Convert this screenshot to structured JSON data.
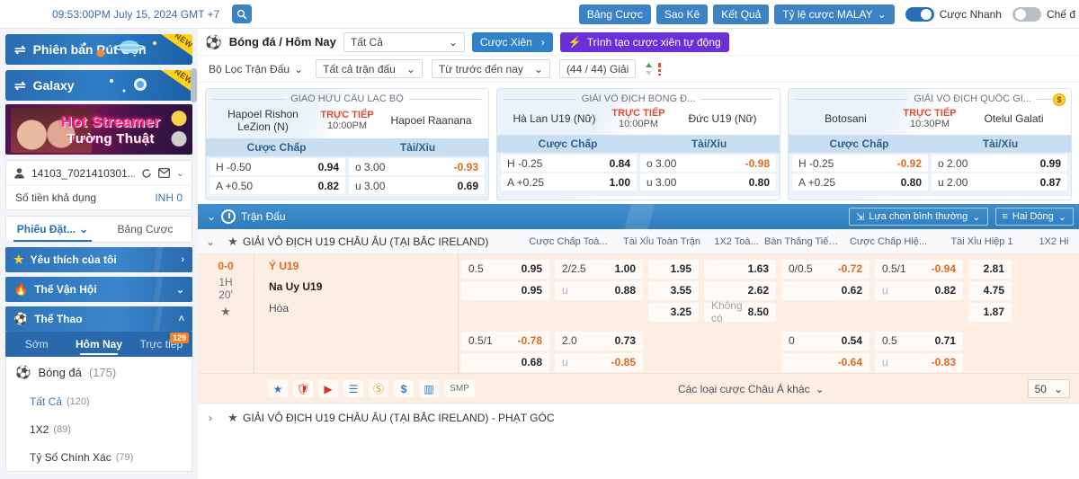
{
  "topbar": {
    "clock": "09:53:00PM July 15, 2024 GMT +7",
    "search_icon": "search-icon",
    "buttons": [
      {
        "label": "Bảng Cược"
      },
      {
        "label": "Sao Kê"
      },
      {
        "label": "Kết Quả"
      },
      {
        "label": "Tỷ lệ cược MALAY",
        "caret": "⌄"
      }
    ],
    "toggles": [
      {
        "label": "Cược Nhanh",
        "state": "on"
      },
      {
        "label": "Chế đ",
        "state": "off"
      }
    ]
  },
  "sidebar": {
    "promos": [
      {
        "label": "Phiên bản Rút Gọn",
        "badge": "NEW",
        "icon": "swap-icon"
      },
      {
        "label": "Galaxy",
        "badge": "NEW",
        "icon": "swap-icon"
      }
    ],
    "banner": {
      "line1": "Hot Streamer",
      "line2": "Tường Thuật"
    },
    "account": {
      "name": "14103_7021410301...",
      "refresh_icon": "refresh-icon",
      "mail_icon": "mail-icon",
      "chevron_icon": "chevron-down-icon",
      "balance_label": "Số tiền khả dụng",
      "balance_value": "INH 0"
    },
    "betslip_tabs": [
      {
        "label": "Phiếu Đặt...",
        "active": true,
        "caret": "⌄"
      },
      {
        "label": "Bảng Cược",
        "active": false
      }
    ],
    "nav": [
      {
        "label": "Yêu thích của tôi",
        "icon": "star-icon",
        "chevron": "›"
      },
      {
        "label": "Thế Vận Hội",
        "icon": "torch-icon",
        "chevron": "⌄"
      },
      {
        "label": "Thể Thao",
        "icon": "soccer-ball-icon",
        "chevron": "˄"
      }
    ],
    "sub_tabs": [
      {
        "label": "Sớm",
        "active": false
      },
      {
        "label": "Hôm Nay",
        "active": true
      },
      {
        "label": "Trực tiếp",
        "active": false,
        "badge": "129"
      }
    ],
    "sport_header": {
      "label": "Bóng đá",
      "count": "(175)",
      "icon": "soccer-ball-icon"
    },
    "sport_items": [
      {
        "label": "Tất Cả",
        "count": "(120)",
        "selected": true
      },
      {
        "label": "1X2",
        "count": "(89)",
        "selected": false
      },
      {
        "label": "Tỷ Số Chính Xác",
        "count": "(79)",
        "selected": false
      }
    ]
  },
  "main": {
    "header": {
      "title": "Bóng đá / Hôm Nay",
      "ball_icon": "soccer-ball-icon",
      "select_all": "Tất Cả",
      "parlay_btn": "Cược Xiên",
      "parlay_arrow": "›",
      "auto_parlay_btn": "Trình tạo cược xiên tự động",
      "auto_parlay_icon": "lightning-icon"
    },
    "filters": [
      {
        "label": "Bộ Lọc Trận Đấu",
        "caret": "⌄",
        "boxed": false
      },
      {
        "label": "Tất cả trận đấu",
        "caret": "⌄",
        "boxed": true
      },
      {
        "label": "Từ trước đến nay",
        "caret": "⌄",
        "boxed": true
      },
      {
        "label": "(44 / 44) Giải",
        "caret": "",
        "boxed": true
      }
    ],
    "sort_icon": "sort-asc-desc-icon",
    "featured_cards": [
      {
        "league": "GIAO HỮU CÂU LẠC BỘ",
        "home": "Hapoel Rishon LeZion (N)",
        "away": "Hapoel Raanana",
        "live_label": "TRỰC TIẾP",
        "time": "10:00PM",
        "coin": false,
        "col1": "Cược Chấp",
        "col2": "Tài/Xỉu",
        "rows": [
          {
            "hk": "H -0.50",
            "hv": "0.94",
            "hneg": false,
            "ok": "o 3.00",
            "ov": "-0.93",
            "oneg": true
          },
          {
            "hk": "A +0.50",
            "hv": "0.82",
            "hneg": false,
            "ok": "u 3.00",
            "ov": "0.69",
            "oneg": false
          }
        ]
      },
      {
        "league": "GIẢI VÔ ĐỊCH BÓNG Đ...",
        "home": "Hà Lan U19 (Nữ)",
        "away": "Đức U19 (Nữ)",
        "live_label": "TRỰC TIẾP",
        "time": "10:00PM",
        "coin": false,
        "col1": "Cược Chấp",
        "col2": "Tài/Xỉu",
        "rows": [
          {
            "hk": "H -0.25",
            "hv": "0.84",
            "hneg": false,
            "ok": "o 3.00",
            "ov": "-0.98",
            "oneg": true
          },
          {
            "hk": "A +0.25",
            "hv": "1.00",
            "hneg": false,
            "ok": "u 3.00",
            "ov": "0.80",
            "oneg": false
          }
        ]
      },
      {
        "league": "GIẢI VÔ ĐỊCH QUỐC GI...",
        "home": "Botosani",
        "away": "Otelul Galati",
        "live_label": "TRỰC TIẾP",
        "time": "10:30PM",
        "coin": true,
        "coin_icon": "coin-icon",
        "col1": "Cược Chấp",
        "col2": "Tài/Xỉu",
        "rows": [
          {
            "hk": "H -0.25",
            "hv": "-0.92",
            "hneg": true,
            "ok": "o 2.00",
            "ov": "0.99",
            "oneg": false
          },
          {
            "hk": "A +0.25",
            "hv": "0.80",
            "hneg": false,
            "ok": "u 2.00",
            "ov": "0.87",
            "oneg": false
          }
        ]
      }
    ],
    "match_bar": {
      "title": "Trận Đấu",
      "chevron": "⌄",
      "clock_icon": "clock-icon",
      "view_option": "Lựa chọn bình thường",
      "view_option_icon": "filter-lines-icon",
      "rows_option": "Hai Dòng",
      "rows_option_icon": "rows-icon"
    },
    "league_row": {
      "chevron": "⌄",
      "star_icon": "star-icon",
      "name": "GIẢI VÔ ĐỊCH U19 CHÂU ÂU (TẠI BẮC IRELAND)"
    },
    "column_headers": [
      "Cược Chấp Toà...",
      "Tài Xỉu Toàn Trận",
      "1X2 Toà...",
      "Bàn Thắng Tiếp...",
      "Cược Chấp Hiệ...",
      "Tài Xỉu Hiệp 1",
      "1X2 Hi"
    ],
    "match": {
      "score": "0-0",
      "period": "1H",
      "minute": "20'",
      "fav_icon": "star-icon",
      "home": "Ý U19",
      "away": "Na Uy U19",
      "draw": "Hòa",
      "rows": [
        [
          {
            "k": "0.5",
            "v": "0.95",
            "neg": false
          },
          {
            "k": "2/2.5",
            "v": "1.00",
            "neg": false
          },
          {
            "k": "",
            "v": "1.95",
            "neg": false,
            "single": true
          },
          {
            "k": "",
            "v": "1.63",
            "neg": false,
            "single": true
          },
          {
            "k": "0/0.5",
            "v": "-0.72",
            "neg": true
          },
          {
            "k": "0.5/1",
            "v": "-0.94",
            "neg": true
          },
          {
            "k": "",
            "v": "2.81",
            "neg": false,
            "single": true
          }
        ],
        [
          {
            "k": "",
            "v": "0.95",
            "neg": false
          },
          {
            "k": "u",
            "v": "0.88",
            "neg": false,
            "under": true
          },
          {
            "k": "",
            "v": "3.55",
            "neg": false,
            "single": true
          },
          {
            "k": "",
            "v": "2.62",
            "neg": false,
            "single": true
          },
          {
            "k": "",
            "v": "0.62",
            "neg": false
          },
          {
            "k": "u",
            "v": "0.82",
            "neg": false,
            "under": true
          },
          {
            "k": "",
            "v": "4.75",
            "neg": false,
            "single": true
          }
        ],
        [
          {
            "blank": true
          },
          {
            "blank": true
          },
          {
            "k": "",
            "v": "3.25",
            "neg": false,
            "single": true
          },
          {
            "k": "Không có",
            "v": "8.50",
            "neg": false,
            "nobet": true
          },
          {
            "blank": true
          },
          {
            "blank": true
          },
          {
            "k": "",
            "v": "1.87",
            "neg": false,
            "single": true
          }
        ],
        [
          {
            "k": "0.5/1",
            "v": "-0.78",
            "neg": true
          },
          {
            "k": "2.0",
            "v": "0.73",
            "neg": false
          },
          {
            "blank": true
          },
          {
            "blank": true
          },
          {
            "k": "0",
            "v": "0.54",
            "neg": false
          },
          {
            "k": "0.5",
            "v": "0.71",
            "neg": false
          },
          {
            "blank": true
          }
        ],
        [
          {
            "k": "",
            "v": "0.68",
            "neg": false
          },
          {
            "k": "u",
            "v": "-0.85",
            "neg": true,
            "under": true
          },
          {
            "blank": true
          },
          {
            "blank": true
          },
          {
            "k": "",
            "v": "-0.64",
            "neg": true
          },
          {
            "k": "u",
            "v": "-0.83",
            "neg": true,
            "under": true
          },
          {
            "blank": true
          }
        ]
      ],
      "icons": [
        {
          "name": "star-icon",
          "glyph": "★"
        },
        {
          "name": "fire-shield-icon",
          "glyph": "◆"
        },
        {
          "name": "play-video-icon",
          "glyph": "▶"
        },
        {
          "name": "stats-table-icon",
          "glyph": "☰"
        },
        {
          "name": "coin-icon",
          "glyph": "Ⓢ"
        },
        {
          "name": "cashout-icon",
          "glyph": "$"
        },
        {
          "name": "bar-chart-icon",
          "glyph": "▐"
        },
        {
          "name": "smp-icon",
          "glyph": "SMP"
        }
      ],
      "other_bets": "Các loại cược Châu Á khác",
      "other_bets_caret": "⌄",
      "page_size": "50",
      "page_size_caret": "⌄"
    },
    "league_row2": {
      "chevron": "›",
      "star_icon": "star-icon",
      "name": "GIẢI VÔ ĐỊCH U19 CHÂU ÂU (TẠI BẮC IRELAND) - PHẠT GÓC"
    }
  }
}
